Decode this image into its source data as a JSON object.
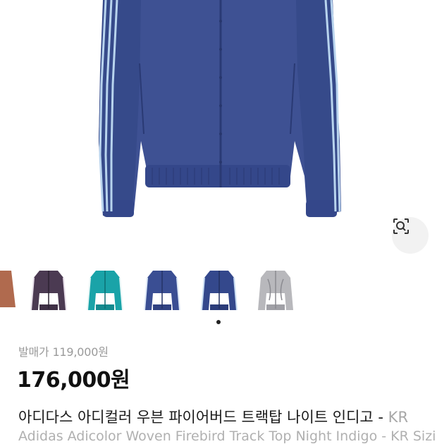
{
  "product": {
    "release_price": "발매가 119,000원",
    "price": "176,000원",
    "title_main": "아디다스 아디컬러 우븐 파이어버드 트랙탑 나이트 인디고 - ",
    "title_suffix": "KR",
    "subtitle": "Adidas Adicolor Woven Firebird Track Top Night Indigo - KR Sizing"
  },
  "gallery": {
    "thumbnails": [
      {
        "name": "brown jacket",
        "color": "#b06a4e"
      },
      {
        "name": "plum jacket",
        "color": "#4b3a52"
      },
      {
        "name": "teal jacket",
        "color": "#1aa3a8"
      },
      {
        "name": "indigo jacket",
        "color": "#3a4e93"
      },
      {
        "name": "indigo jacket alt",
        "color": "#34488c"
      },
      {
        "name": "grey jacket",
        "color": "#b8b8bc"
      }
    ],
    "active_index": 4
  },
  "colors": {
    "jacket": "#3e5193",
    "jacket_shadow": "#2d3d78",
    "stripe": "#b8d4ee"
  }
}
